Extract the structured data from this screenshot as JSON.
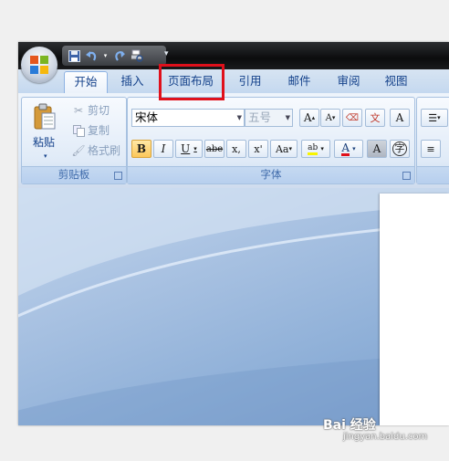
{
  "quick_access": {
    "icons": [
      "save-icon",
      "undo-icon",
      "dropdown-icon",
      "redo-icon",
      "print-preview-icon",
      "customize-icon"
    ]
  },
  "tabs": [
    {
      "label": "开始",
      "active": true
    },
    {
      "label": "插入",
      "active": false
    },
    {
      "label": "页面布局",
      "active": false,
      "highlighted": true
    },
    {
      "label": "引用",
      "active": false
    },
    {
      "label": "邮件",
      "active": false
    },
    {
      "label": "审阅",
      "active": false
    },
    {
      "label": "视图",
      "active": false
    }
  ],
  "clipboard": {
    "paste_label": "粘贴",
    "cut_label": "剪切",
    "copy_label": "复制",
    "format_painter_label": "格式刷",
    "group_label": "剪贴板"
  },
  "font": {
    "font_name": "宋体",
    "font_size": "五号",
    "group_label": "字体",
    "grow_label": "A",
    "shrink_label": "A",
    "bold_label": "B",
    "italic_label": "I",
    "underline_label": "U",
    "strike_label": "abe",
    "subscript_label": "x,",
    "superscript_label": "x'",
    "case_label": "Aa",
    "highlight_label": "ab",
    "font_color_label": "A",
    "char_shading_label": "A",
    "enclose_label": "字",
    "phonetic_label": "文",
    "clear_label": "A"
  },
  "colors": {
    "highlight_box": "#e0101b",
    "font_color_bar": "#e0101b",
    "highlight_bar": "#f8f400"
  },
  "watermark": {
    "text": "Bai 经验",
    "sub": "jingyan.baidu.com"
  }
}
